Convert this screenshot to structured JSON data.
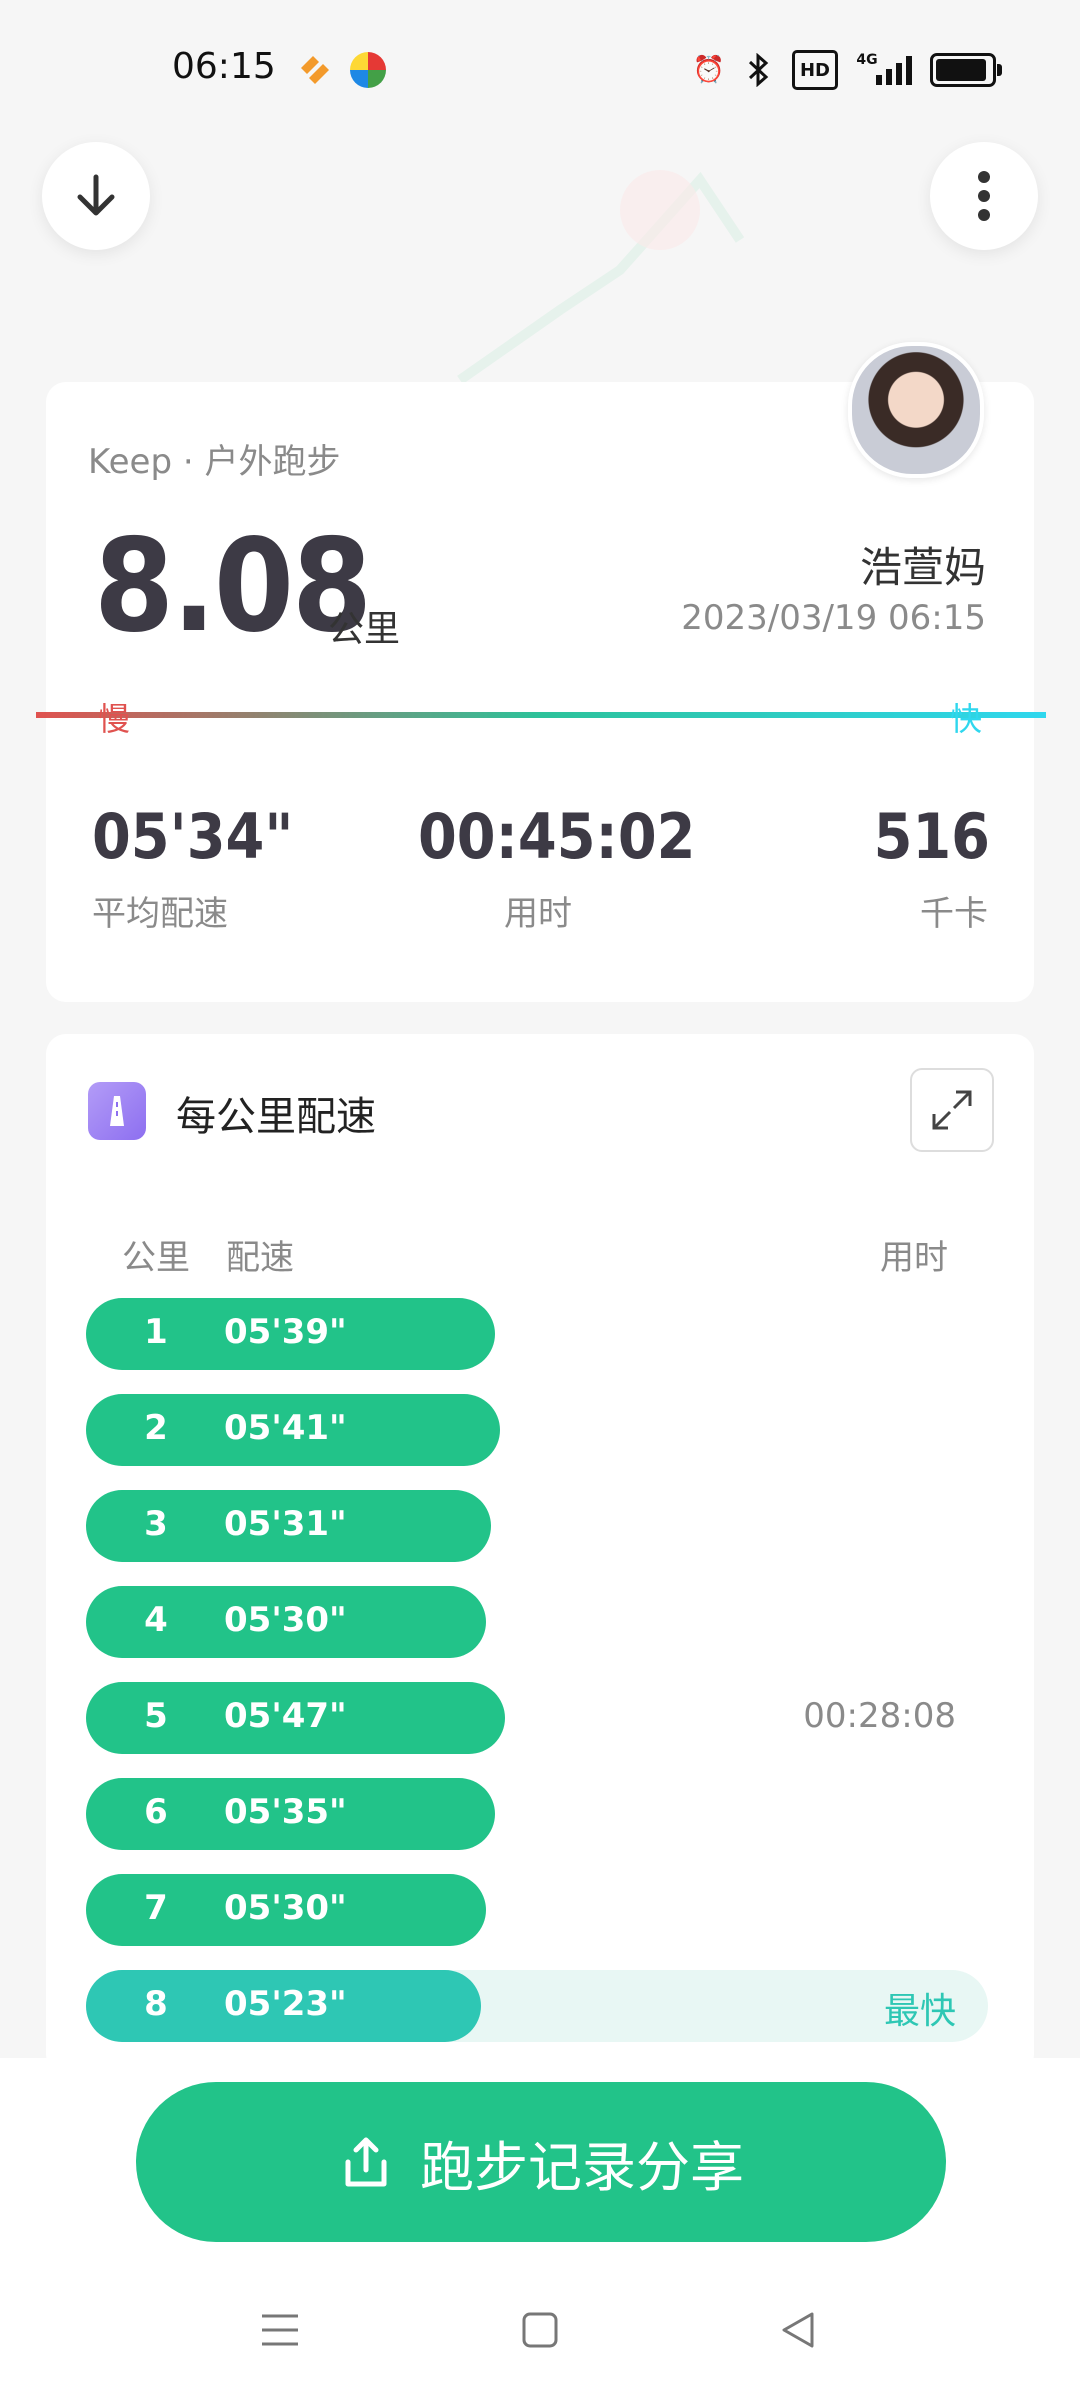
{
  "status_bar": {
    "time": "06:15",
    "icons": [
      "alarm-icon",
      "bluetooth-icon",
      "hd-icon",
      "signal-4g-icon",
      "battery-icon"
    ],
    "network": "4G",
    "hd": "HD"
  },
  "summary": {
    "source": "Keep · 户外跑步",
    "distance": "8.08",
    "distance_unit": "公里",
    "user_name": "浩萱妈",
    "datetime": "2023/03/19 06:15",
    "slow_label": "慢",
    "fast_label": "快",
    "stats": [
      {
        "value": "05'34\"",
        "label": "平均配速"
      },
      {
        "value": "00:45:02",
        "label": "用时"
      },
      {
        "value": "516",
        "label": "千卡"
      }
    ]
  },
  "splits": {
    "title": "每公里配速",
    "col_km": "公里",
    "col_pace": "配速",
    "col_time": "用时",
    "rows": [
      {
        "km": "1",
        "pace": "05'39\"",
        "fraction": 0.88,
        "time": "",
        "tag": ""
      },
      {
        "km": "2",
        "pace": "05'41\"",
        "fraction": 0.89,
        "time": "",
        "tag": ""
      },
      {
        "km": "3",
        "pace": "05'31\"",
        "fraction": 0.87,
        "time": "",
        "tag": ""
      },
      {
        "km": "4",
        "pace": "05'30\"",
        "fraction": 0.86,
        "time": "",
        "tag": ""
      },
      {
        "km": "5",
        "pace": "05'47\"",
        "fraction": 0.9,
        "time": "00:28:08",
        "tag": ""
      },
      {
        "km": "6",
        "pace": "05'35\"",
        "fraction": 0.88,
        "time": "",
        "tag": ""
      },
      {
        "km": "7",
        "pace": "05'30\"",
        "fraction": 0.86,
        "time": "",
        "tag": ""
      },
      {
        "km": "8",
        "pace": "05'23\"",
        "fraction": 0.85,
        "time": "",
        "tag": "最快"
      }
    ]
  },
  "share_button": {
    "label": "跑步记录分享"
  },
  "colors": {
    "accent": "#22c389",
    "fastest": "#2ec7b4",
    "slow": "#e0524f",
    "fast": "#2fd7ee"
  }
}
